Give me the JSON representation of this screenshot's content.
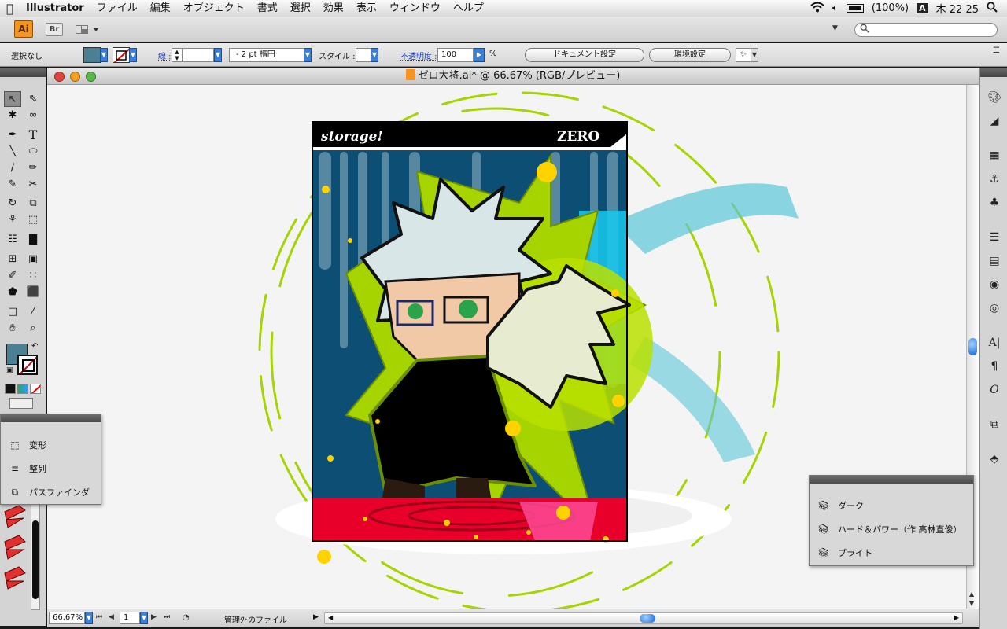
{
  "menubar": {
    "apple_icon": "apple-icon",
    "items": [
      "Illustrator",
      "ファイル",
      "編集",
      "オブジェクト",
      "書式",
      "選択",
      "効果",
      "表示",
      "ウィンドウ",
      "ヘルプ"
    ],
    "battery": "(100%)",
    "input_mode": "A",
    "clock": "木 22 25"
  },
  "appbar": {
    "ai_label": "Ai",
    "br_label": "Br"
  },
  "control": {
    "selection_status": "選択なし",
    "stroke_label": "線 :",
    "brush_value": "2 pt 楕円",
    "style_label": "スタイル :",
    "opacity_label": "不透明度 :",
    "opacity_value": "100",
    "opacity_unit": "%",
    "doc_settings": "ドキュメント設定",
    "prefs": "環境設定"
  },
  "document": {
    "title": "ゼロ大将.ai* @ 66.67% (RGB/プレビュー)",
    "artwork_header": "storage!",
    "artwork_name": "ZERO"
  },
  "status": {
    "zoom": "66.67%",
    "artboard": "1",
    "info": "管理外のファイル"
  },
  "panel_left": {
    "items": [
      {
        "icon": "transform-icon",
        "label": "変形"
      },
      {
        "icon": "align-icon",
        "label": "整列"
      },
      {
        "icon": "pathfinder-icon",
        "label": "パスファインダ"
      }
    ]
  },
  "panel_right": {
    "items": [
      {
        "icon": "library-icon",
        "label": "ダーク"
      },
      {
        "icon": "library-icon",
        "label": "ハード＆パワー（作 高林直俊）"
      },
      {
        "icon": "library-icon",
        "label": "ブライト"
      }
    ]
  },
  "colors": {
    "fill": "#4b7f94",
    "accent_lime": "#a6d400",
    "accent_orange": "#f7941d"
  }
}
